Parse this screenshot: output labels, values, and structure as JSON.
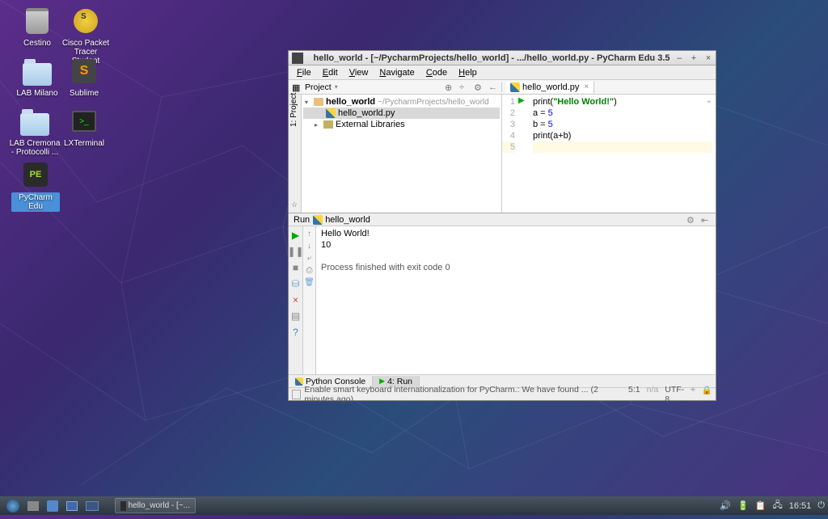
{
  "desktop": {
    "icons": [
      {
        "label": "Cestino"
      },
      {
        "label": "Cisco Packet Tracer Student"
      },
      {
        "label": "LAB Milano"
      },
      {
        "label": "Sublime"
      },
      {
        "label": "LAB Cremona - Protocolli ..."
      },
      {
        "label": "LXTerminal"
      },
      {
        "label": "PyCharm Edu"
      }
    ]
  },
  "window": {
    "title": "hello_world - [~/PycharmProjects/hello_world] - .../hello_world.py - PyCharm Edu 3.5",
    "menu": [
      "File",
      "Edit",
      "View",
      "Navigate",
      "Code",
      "Help"
    ],
    "project_label": "Project",
    "sidebar_tab": "1: Project",
    "tree": {
      "root": "hello_world",
      "root_path": "~/PycharmProjects/hello_world",
      "file": "hello_world.py",
      "ext_libs": "External Libraries"
    },
    "editor_tab": "hello_world.py",
    "code": {
      "line1_fn": "print",
      "line1_open": "(",
      "line1_str": "\"Hello World!\"",
      "line1_close": ")",
      "line2_a": "a = ",
      "line2_v": "5",
      "line3_a": "b = ",
      "line3_v": "5",
      "line4_fn": "print",
      "line4_arg": "(a+b)"
    },
    "run": {
      "header": "Run",
      "config": "hello_world",
      "out1": "Hello World!",
      "out2": "10",
      "exit": "Process finished with exit code 0"
    },
    "bottom_tabs": {
      "console": "Python Console",
      "run": "4: Run"
    },
    "status": {
      "message": "Enable smart keyboard internationalization for PyCharm.: We have found ... (2 minutes ago)",
      "pos": "5:1",
      "na": "n/a",
      "enc": "UTF-8",
      "term": "÷"
    }
  },
  "taskbar": {
    "app": "hello_world - [~...",
    "clock": "16:51"
  }
}
